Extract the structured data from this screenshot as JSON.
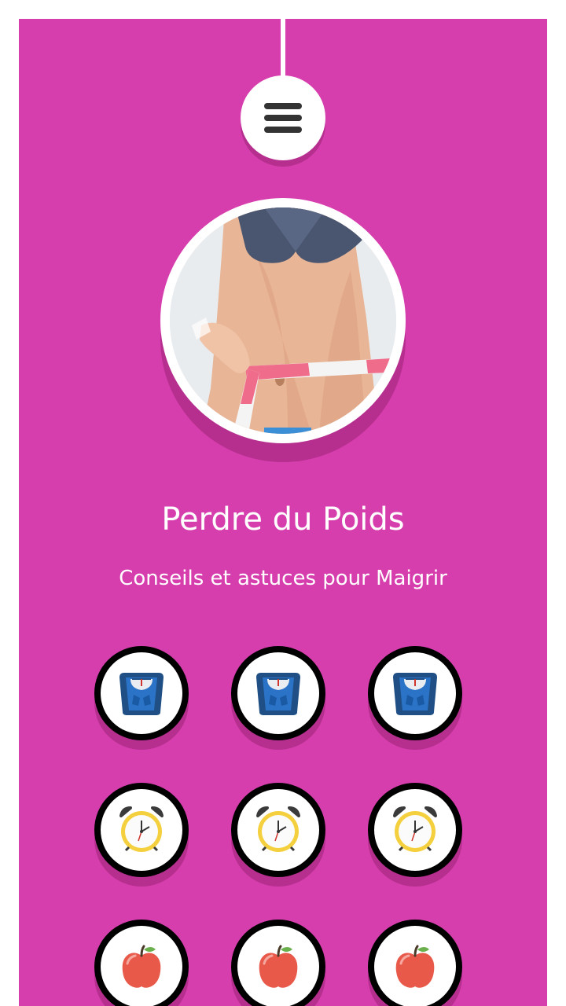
{
  "header": {
    "menu_icon": "hamburger-menu-icon"
  },
  "hero": {
    "image_subject": "waist-measuring-tape-photo"
  },
  "title": "Perdre du Poids",
  "subtitle": "Conseils et astuces pour Maigrir",
  "grid": {
    "rows": [
      {
        "icon": "scale-icon",
        "items": 3
      },
      {
        "icon": "alarm-clock-icon",
        "items": 3
      },
      {
        "icon": "apple-icon",
        "items": 3
      }
    ]
  },
  "colors": {
    "background": "#d73ead",
    "accent_white": "#ffffff",
    "tile_ring": "#000000"
  }
}
